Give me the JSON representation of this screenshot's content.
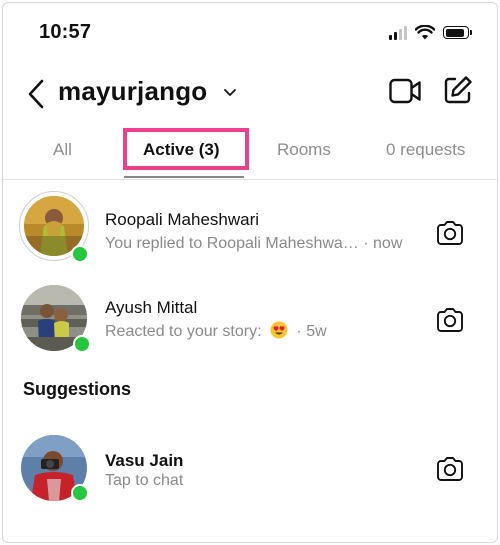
{
  "status_bar": {
    "time": "10:57",
    "icons": [
      "cellular-signal-icon",
      "wifi-icon",
      "battery-icon"
    ]
  },
  "header": {
    "username": "mayurjango",
    "icons": [
      "back-chevron-icon",
      "chevron-down-icon",
      "video-call-icon",
      "compose-icon"
    ]
  },
  "tabs": [
    {
      "label": "All",
      "selected": false
    },
    {
      "label": "Active (3)",
      "selected": true
    },
    {
      "label": "Rooms",
      "selected": false
    },
    {
      "label": "0 requests",
      "selected": false
    }
  ],
  "active_threads": [
    {
      "name": "Roopali Maheshwari",
      "preview": "You replied to Roopali Maheshwa…",
      "time": "· now",
      "online": true,
      "has_story_ring": true
    },
    {
      "name": "Ayush Mittal",
      "preview": "Reacted to your story:",
      "reaction": "heart-eyes-emoji",
      "time": "· 5w",
      "online": true,
      "has_story_ring": false
    }
  ],
  "suggestions": {
    "title": "Suggestions",
    "items": [
      {
        "name": "Vasu Jain",
        "preview": "Tap to chat",
        "online": true
      }
    ]
  },
  "colors": {
    "online": "#24c73d",
    "highlight_box": "#ee3f8c",
    "secondary_text": "#8a8a8a"
  }
}
